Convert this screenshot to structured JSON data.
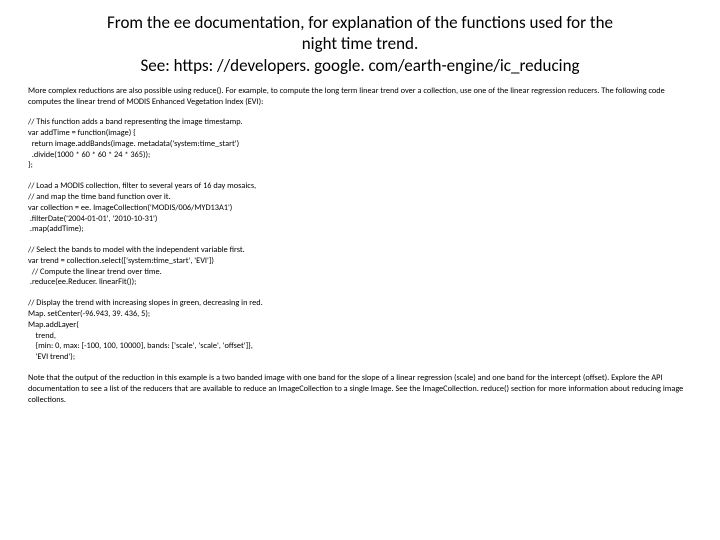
{
  "title_line1": "From the ee documentation, for explanation of the functions used for the",
  "title_line2": "night time trend.",
  "title_line3": "See: https: //developers. google. com/earth-engine/ic_reducing",
  "intro": "More complex reductions are also possible using reduce(). For example, to compute the long term linear trend over a collection, use one of the linear regression reducers. The following code computes the linear trend of MODIS Enhanced Vegetation Index (EVI):",
  "code1": "// This function adds a band representing the image timestamp.\nvar addTime = function(image) {\n  return image.addBands(image. metadata('system:time_start')\n  .divide(1000 * 60 * 60 * 24 * 365));\n};",
  "code2": "// Load a MODIS collection, filter to several years of 16 day mosaics,\n// and map the time band function over it.\nvar collection = ee. ImageCollection('MODIS/006/MYD13A1')\n .filterDate('2004-01-01', '2010-10-31')\n .map(addTime);",
  "code3": "// Select the bands to model with the independent variable first.\nvar trend = collection.select(['system:time_start', 'EVI'])\n  // Compute the linear trend over time.\n .reduce(ee.Reducer. linearFit());",
  "code4": "// Display the trend with increasing slopes in green, decreasing in red.\nMap. setCenter(-96.943, 39. 436, 5);\nMap.addLayer(\n    trend,\n    {min: 0, max: [-100, 100, 10000], bands: ['scale', 'scale', 'offset']},\n    'EVI trend');",
  "note": "Note that the output of the reduction in this example is a two banded image with one band for the slope of a linear regression (scale) and one band for the intercept (offset). Explore the API documentation to see a list of the reducers that are available to reduce an ImageCollection to a single Image. See the ImageCollection. reduce() section for more information about reducing image collections."
}
